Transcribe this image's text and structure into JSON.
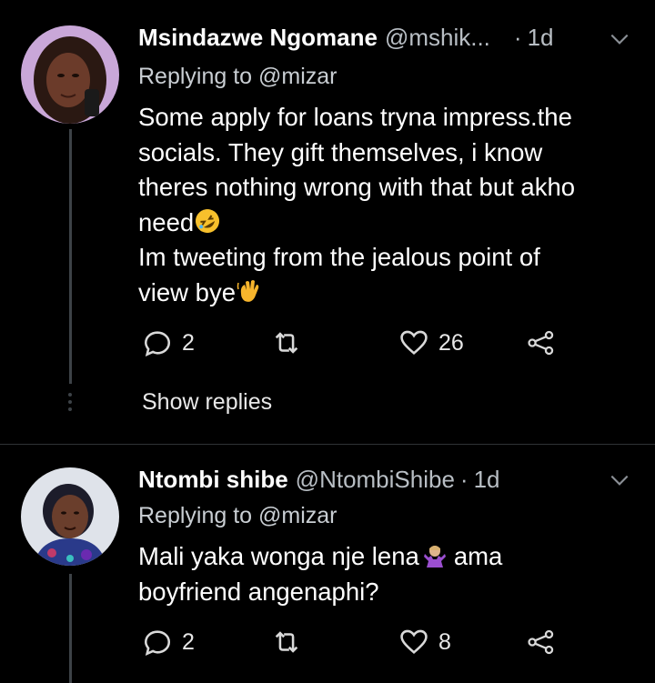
{
  "tweets": [
    {
      "name": "Msindazwe Ngomane",
      "handle": "@mshik...",
      "separator": "·",
      "time": "1d",
      "replying_to": "Replying to @mizar",
      "lines": [
        "Some apply for loans tryna impress.the",
        "socials. They gift themselves, i know",
        "theres nothing wrong with that but akho",
        "need",
        "Im tweeting from the jealous point of",
        "view bye"
      ],
      "emojis": [
        "rolling-on-floor-laughing",
        "waving-hand"
      ],
      "replies": "2",
      "likes": "26",
      "show_replies": "Show replies"
    },
    {
      "name": "Ntombi shibe",
      "handle": "@NtombiShibe",
      "separator": "·",
      "time": "1d",
      "replying_to": "Replying to @mizar",
      "lines": [
        "Mali yaka wonga nje lena",
        "ama",
        "boyfriend angenaphi?"
      ],
      "emojis": [
        "person-shrugging"
      ],
      "replies": "2",
      "likes": "8"
    }
  ],
  "colors": {
    "background": "#000000",
    "muted": "#b8bec4",
    "thread_line": "#3d4247"
  }
}
